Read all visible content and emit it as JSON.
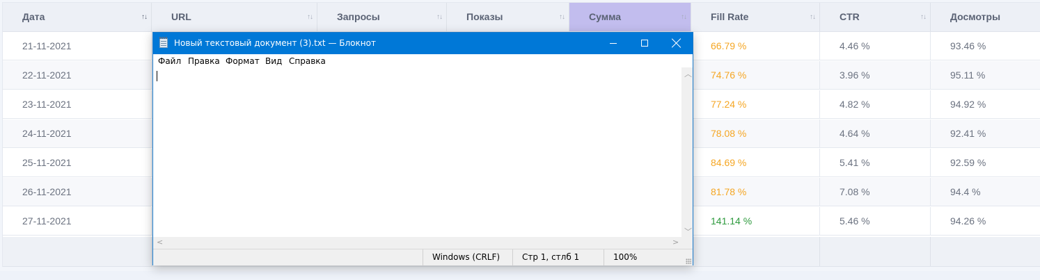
{
  "table": {
    "columns": [
      {
        "label": "Дата"
      },
      {
        "label": "URL"
      },
      {
        "label": "Запросы"
      },
      {
        "label": "Показы"
      },
      {
        "label": "Сумма",
        "active": true
      },
      {
        "label": "Fill Rate"
      },
      {
        "label": "CTR"
      },
      {
        "label": "Досмотры"
      }
    ],
    "sort_glyph": "↑↓",
    "rows": [
      {
        "date": "21-11-2021",
        "fill_rate": "66.79 %",
        "fill_status": "orange",
        "ctr": "4.46 %",
        "views": "93.46 %"
      },
      {
        "date": "22-11-2021",
        "fill_rate": "74.76 %",
        "fill_status": "orange",
        "ctr": "3.96 %",
        "views": "95.11 %"
      },
      {
        "date": "23-11-2021",
        "fill_rate": "77.24 %",
        "fill_status": "orange",
        "ctr": "4.82 %",
        "views": "94.92 %"
      },
      {
        "date": "24-11-2021",
        "fill_rate": "78.08 %",
        "fill_status": "orange",
        "ctr": "4.64 %",
        "views": "92.41 %"
      },
      {
        "date": "25-11-2021",
        "fill_rate": "84.69 %",
        "fill_status": "orange",
        "ctr": "5.41 %",
        "views": "92.59 %"
      },
      {
        "date": "26-11-2021",
        "fill_rate": "81.78 %",
        "fill_status": "orange",
        "ctr": "7.08 %",
        "views": "94.4 %"
      },
      {
        "date": "27-11-2021",
        "fill_rate": "141.14 %",
        "fill_status": "green",
        "ctr": "5.46 %",
        "views": "94.26 %"
      }
    ],
    "colors": {
      "header_bg": "#edf0f6",
      "active_header_bg": "#c2bdee",
      "orange": "#f5a623",
      "green": "#2e9a3e"
    }
  },
  "notepad": {
    "title": "Новый текстовый документ (3).txt — Блокнот",
    "menu": [
      "Файл",
      "Правка",
      "Формат",
      "Вид",
      "Справка"
    ],
    "content": "",
    "status": {
      "encoding": "Windows (CRLF)",
      "position": "Стр 1, стлб 1",
      "zoom": "100%"
    },
    "title_color": "#0078d7",
    "icons": [
      "notepad-app-icon",
      "minimize-icon",
      "maximize-icon",
      "close-icon"
    ]
  }
}
